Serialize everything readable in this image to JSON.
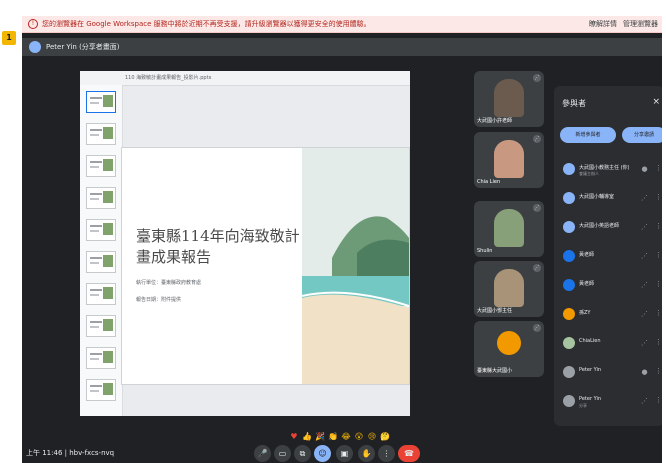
{
  "browser": {
    "notice_text": "您的瀏覽器在 Google Workspace 服務中將於近期不再受支援，請升級瀏覽器以獲得更安全的使用體驗。",
    "notice_learn": "瞭解詳情",
    "notice_manage": "管理瀏覽器",
    "notice_icon": "info-icon"
  },
  "meeting": {
    "presenter_label": "Peter Yin (分享者畫面)",
    "time": "上午 11:46",
    "meeting_code": "hbv-fxcs-nvq",
    "side_badge": "1"
  },
  "slide": {
    "toolbar_text": "110 海致敏計畫成果報告_投影片.pptx",
    "title": "臺東縣114年向海致敬計畫成果報告",
    "line1": "執行單位：臺東縣政府教育處",
    "line2": "報告日期：附件提供",
    "art_sky": "#dfe8e6",
    "art_sea": "#6fc4c2",
    "art_sand": "#f2e2c9"
  },
  "thumbnails": [
    "1",
    "2",
    "3",
    "4",
    "5",
    "6",
    "7",
    "8",
    "9",
    "10"
  ],
  "reactions": [
    "♥",
    "👍",
    "🎉",
    "👏",
    "😂",
    "😮",
    "😢",
    "🤔",
    "👎"
  ],
  "tiles": [
    {
      "name": "大武國小許老師",
      "color": "#6b5b4f"
    },
    {
      "name": "Chia Lien",
      "color": "#c89880"
    },
    {
      "name": "Shulin",
      "color": "#87a07a"
    },
    {
      "name": "大武國小鄧主任",
      "color": "#a89278"
    },
    {
      "name": "臺東縣大武國小",
      "color": "#f29900"
    }
  ],
  "participants_panel": {
    "title": "參與者",
    "close": "×",
    "add_button": "新增參與者",
    "share_button": "分享邀請",
    "rows": [
      {
        "name": "大武國小教務主任 (你)",
        "sub": "會議主辦人",
        "avatar_color": "#8ab4f8",
        "mic": "●"
      },
      {
        "name": "大武國小輔導室",
        "sub": "",
        "avatar_color": "#8ab4f8",
        "mic": "⋰"
      },
      {
        "name": "大武國小英語老師",
        "sub": "",
        "avatar_color": "#8ab4f8",
        "mic": "⋰"
      },
      {
        "name": "黃老師",
        "sub": "",
        "avatar_color": "#1a73e8",
        "mic": "⋰"
      },
      {
        "name": "黃老師",
        "sub": "",
        "avatar_color": "#1a73e8",
        "mic": "⋰"
      },
      {
        "name": "孫ZY",
        "sub": "",
        "avatar_color": "#f29900",
        "mic": "⋰"
      },
      {
        "name": "ChiaLien",
        "sub": "",
        "avatar_color": "#a7c4a0",
        "mic": "⋰"
      },
      {
        "name": "Peter Yin",
        "sub": "",
        "avatar_color": "#9aa0a6",
        "mic": "●"
      },
      {
        "name": "Peter Yin",
        "sub": "分享",
        "avatar_color": "#9aa0a6",
        "mic": "⋰"
      }
    ]
  },
  "controls": [
    "mic",
    "cam",
    "cc",
    "emoji",
    "present",
    "hand",
    "more",
    "end"
  ]
}
